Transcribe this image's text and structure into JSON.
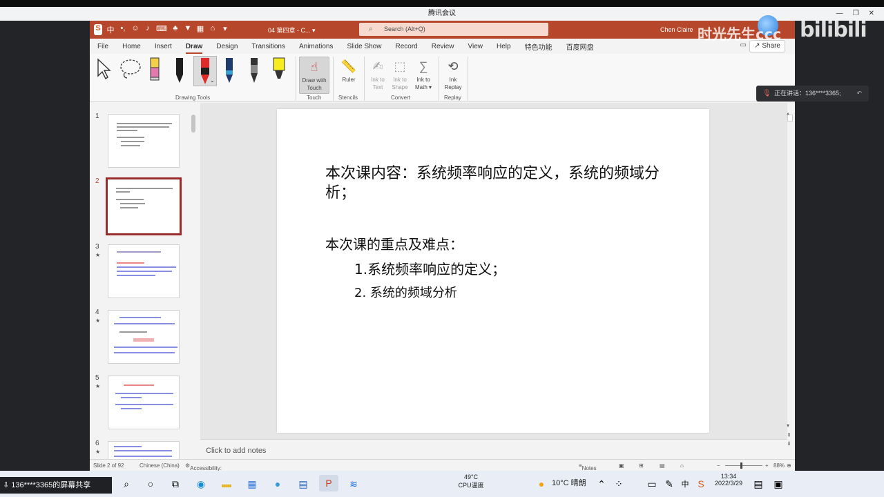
{
  "meeting": {
    "title": "腾讯会议",
    "share_label": "136****3365的屏幕共享",
    "speaking": "正在讲话：136****3365;"
  },
  "overlay": {
    "watermark": "时光先生ccc",
    "bili": "bilibili"
  },
  "ppt": {
    "doc_name": "04 第四章 - C...",
    "search_placeholder": "Search (Alt+Q)",
    "user": "Chen Claire",
    "share": "Share",
    "tabs": [
      "File",
      "Home",
      "Insert",
      "Draw",
      "Design",
      "Transitions",
      "Animations",
      "Slide Show",
      "Record",
      "Review",
      "View",
      "Help",
      "特色功能",
      "百度网盘"
    ],
    "active_tab": "Draw",
    "ribbon": {
      "drawing_tools_label": "Drawing Tools",
      "touch_label": "Touch",
      "stencils_label": "Stencils",
      "convert_label": "Convert",
      "replay_label": "Replay",
      "draw_with_touch_1": "Draw with",
      "draw_with_touch_2": "Touch",
      "ruler": "Ruler",
      "ink_to_text_1": "Ink to",
      "ink_to_text_2": "Text",
      "ink_to_shape_1": "Ink to",
      "ink_to_shape_2": "Shape",
      "ink_to_math_1": "Ink to",
      "ink_to_math_2": "Math ▾",
      "ink_replay_1": "Ink",
      "ink_replay_2": "Replay"
    },
    "thumbnails": [
      "1",
      "2",
      "3",
      "4",
      "5",
      "6"
    ],
    "slide": {
      "line1": "本次课内容：系统频率响应的定义，系统的频域分析；",
      "line2": "本次课的重点及难点：",
      "item1": "1.系统频率响应的定义；",
      "item2": "2. 系统的频域分析"
    },
    "notes_placeholder": "Click to add notes",
    "status": {
      "slide_of": "Slide 2 of 92",
      "language": "Chinese (China)",
      "accessibility": "Accessibility: Unavailable",
      "notes": "Notes",
      "zoom": "88%"
    }
  },
  "taskbar": {
    "cpu_temp": "49°C",
    "cpu_label": "CPU温度",
    "weather": "10°C 晴朗",
    "ime": "中",
    "time": "13:34",
    "date": "2022/3/29"
  }
}
